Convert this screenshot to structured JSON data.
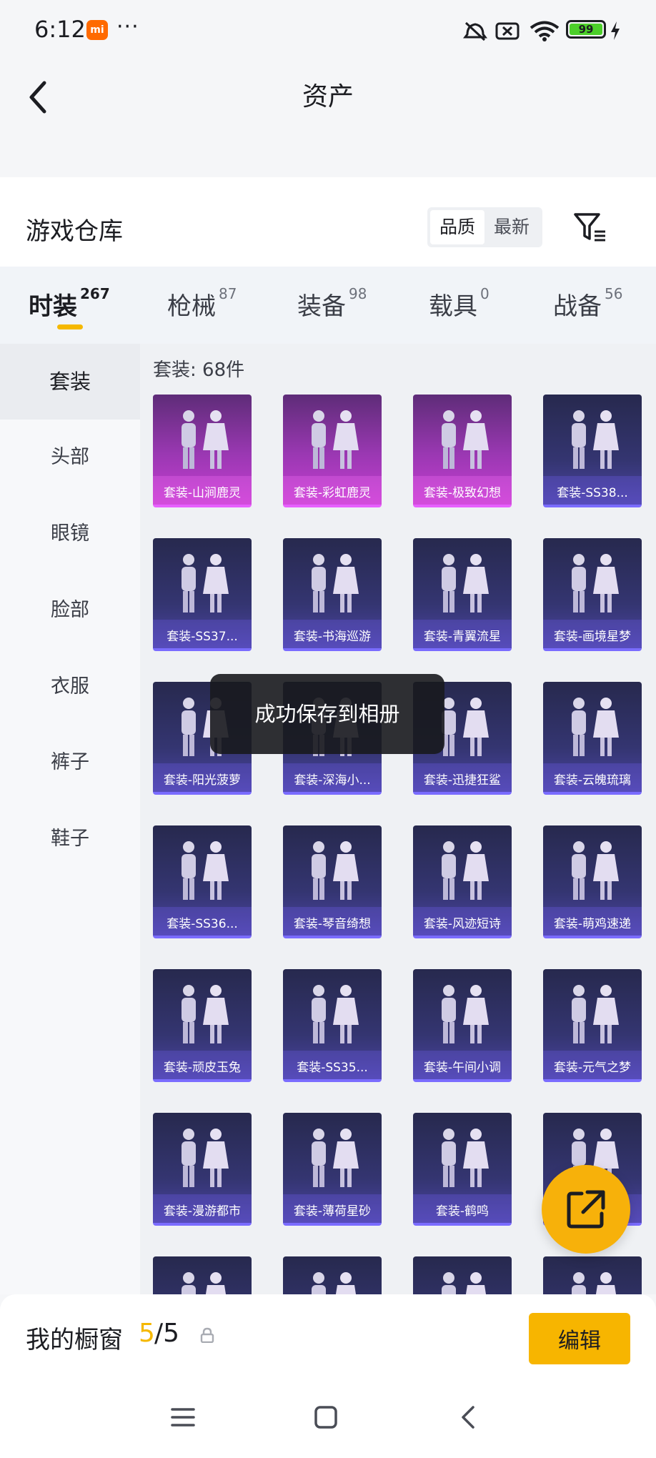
{
  "status_bar": {
    "time": "6:12",
    "mi_badge": "mi",
    "overflow": "···",
    "battery": "99"
  },
  "header": {
    "title": "资产"
  },
  "warehouse": {
    "title": "游戏仓库",
    "sort_quality": "品质",
    "sort_newest": "最新"
  },
  "tabs": [
    {
      "label": "时装",
      "count": "267"
    },
    {
      "label": "枪械",
      "count": "87"
    },
    {
      "label": "装备",
      "count": "98"
    },
    {
      "label": "载具",
      "count": "0"
    },
    {
      "label": "战备",
      "count": "56"
    }
  ],
  "sidebar": [
    "套装",
    "头部",
    "眼镜",
    "脸部",
    "衣服",
    "裤子",
    "鞋子"
  ],
  "grid": {
    "count_label": "套装: 68件",
    "items": [
      {
        "name": "套装-山涧鹿灵",
        "rarity": "purple"
      },
      {
        "name": "套装-彩虹鹿灵",
        "rarity": "purple"
      },
      {
        "name": "套装-极致幻想",
        "rarity": "purple"
      },
      {
        "name": "套装-SS38...",
        "rarity": "blue"
      },
      {
        "name": "套装-SS37...",
        "rarity": "blue"
      },
      {
        "name": "套装-书海巡游",
        "rarity": "blue"
      },
      {
        "name": "套装-青翼流星",
        "rarity": "blue"
      },
      {
        "name": "套装-画境星梦",
        "rarity": "blue"
      },
      {
        "name": "套装-阳光菠萝",
        "rarity": "blue"
      },
      {
        "name": "套装-深海小...",
        "rarity": "blue"
      },
      {
        "name": "套装-迅捷狂鲨",
        "rarity": "blue"
      },
      {
        "name": "套装-云魄琉璃",
        "rarity": "blue"
      },
      {
        "name": "套装-SS36...",
        "rarity": "blue"
      },
      {
        "name": "套装-琴音绮想",
        "rarity": "blue"
      },
      {
        "name": "套装-风迹短诗",
        "rarity": "blue"
      },
      {
        "name": "套装-萌鸡速递",
        "rarity": "blue"
      },
      {
        "name": "套装-顽皮玉兔",
        "rarity": "blue"
      },
      {
        "name": "套装-SS35...",
        "rarity": "blue"
      },
      {
        "name": "套装-午间小调",
        "rarity": "blue"
      },
      {
        "name": "套装-元气之梦",
        "rarity": "blue"
      },
      {
        "name": "套装-漫游都市",
        "rarity": "blue"
      },
      {
        "name": "套装-薄荷星砂",
        "rarity": "blue"
      },
      {
        "name": "套装-鹤鸣",
        "rarity": "blue"
      },
      {
        "name": "",
        "rarity": "blue"
      },
      {
        "name": "",
        "rarity": "blue"
      },
      {
        "name": "",
        "rarity": "blue"
      },
      {
        "name": "",
        "rarity": "blue"
      },
      {
        "name": "",
        "rarity": "blue"
      }
    ]
  },
  "toast": "成功保存到相册",
  "showcase": {
    "label": "我的橱窗",
    "current": "5",
    "total": "/5",
    "edit": "编辑"
  },
  "colors": {
    "accent": "#f7b500",
    "purple_card": "#c53ed0",
    "blue_card": "#4c44a4"
  }
}
